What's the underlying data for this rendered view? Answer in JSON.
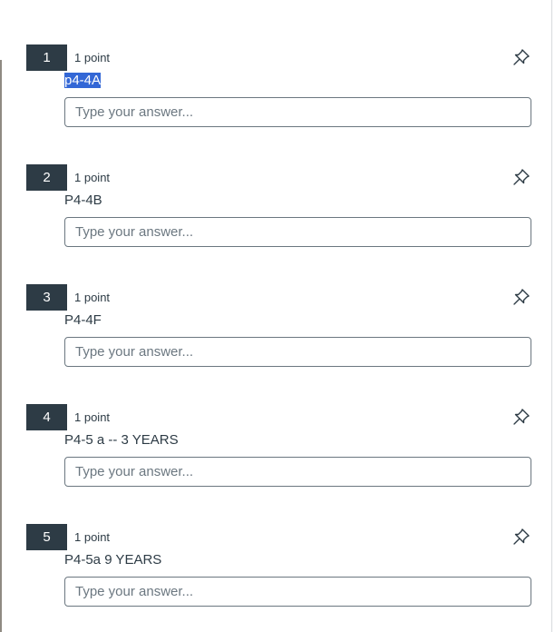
{
  "questions": [
    {
      "number": "1",
      "points": "1 point",
      "text": "p4-4A",
      "placeholder": "Type your answer...",
      "value": ""
    },
    {
      "number": "2",
      "points": "1 point",
      "text": "P4-4B",
      "placeholder": "Type your answer...",
      "value": ""
    },
    {
      "number": "3",
      "points": "1 point",
      "text": "P4-4F",
      "placeholder": "Type your answer...",
      "value": ""
    },
    {
      "number": "4",
      "points": "1 point",
      "text": "P4-5 a -- 3 YEARS",
      "placeholder": "Type your answer...",
      "value": ""
    },
    {
      "number": "5",
      "points": "1 point",
      "text": "P4-5a 9 YEARS",
      "placeholder": "Type your answer...",
      "value": ""
    }
  ],
  "icons": {
    "pin": "pushpin-icon"
  },
  "colors": {
    "number_badge": "#2d3b45",
    "text_selection": "#3367d6"
  }
}
